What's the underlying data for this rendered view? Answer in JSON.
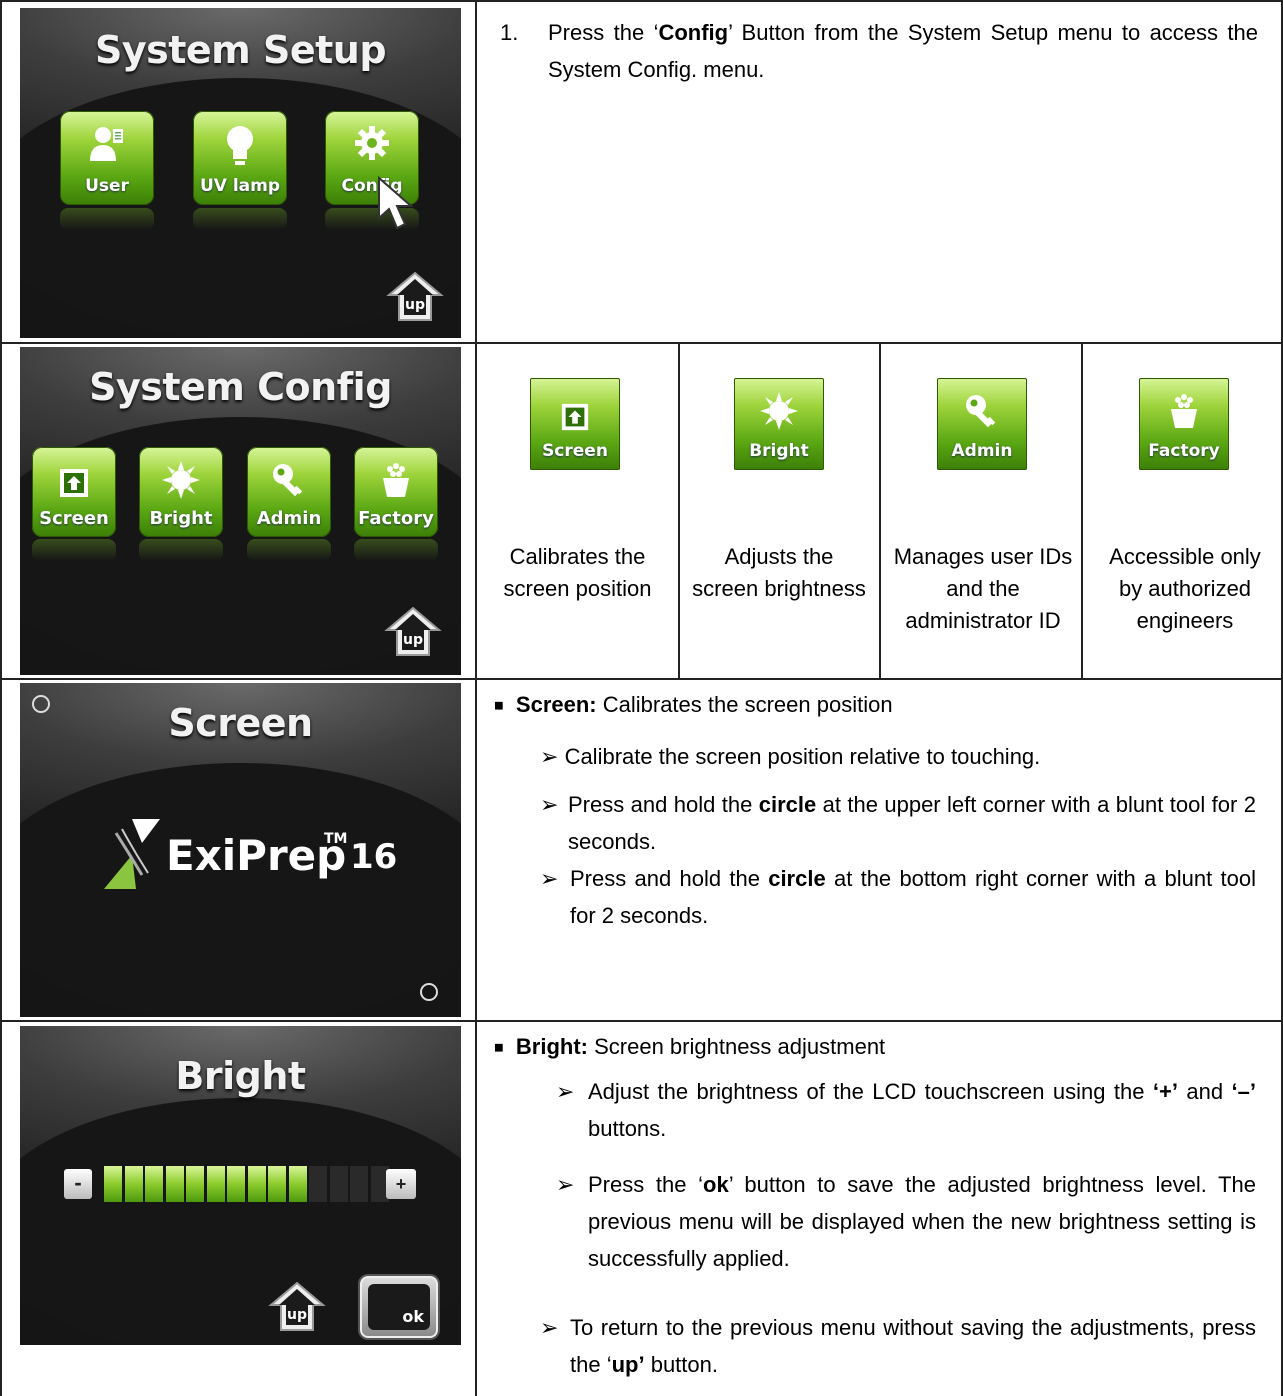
{
  "row1": {
    "screen_title": "System Setup",
    "buttons": [
      "User",
      "UV lamp",
      "Config"
    ],
    "up_label": "up",
    "step_number": "1.",
    "step_pre": "Press the ‘",
    "step_bold": "Config",
    "step_post": "’ Button from the System Setup menu to access the System Config. menu."
  },
  "row2": {
    "screen_title": "System Config",
    "buttons": [
      "Screen",
      "Bright",
      "Admin",
      "Factory"
    ],
    "up_label": "up",
    "cells": [
      {
        "label": "Screen",
        "desc": "Calibrates the screen position"
      },
      {
        "label": "Bright",
        "desc": "Adjusts the screen brightness"
      },
      {
        "label": "Admin",
        "desc": "Manages user IDs and the administrator ID"
      },
      {
        "label": "Factory",
        "desc": "Accessible only by authorized engineers"
      }
    ]
  },
  "row3": {
    "screen_title": "Screen",
    "logo_text": "ExiPrep",
    "logo_tm": "TM",
    "logo_num": "16",
    "heading_bold": "Screen:",
    "heading_rest": " Calibrates the screen position",
    "b1": "Calibrate the screen position relative to touching.",
    "b2_pre": "Press and hold the ",
    "b2_bold": "circle",
    "b2_post": " at the upper left corner with a blunt tool for 2 seconds.",
    "b3_pre": "Press and hold the ",
    "b3_bold": "circle",
    "b3_post": " at the bottom right corner with a blunt tool for 2 seconds."
  },
  "row4": {
    "screen_title": "Bright",
    "minus": "-",
    "plus": "+",
    "brightness_level": 10,
    "brightness_max": 14,
    "up_label": "up",
    "ok_label": "ok",
    "heading_bold": "Bright:",
    "heading_rest": " Screen brightness adjustment",
    "b1_pre": "Adjust the brightness of the LCD touchscreen using the ",
    "b1_plus": "‘+’",
    "b1_mid": " and ",
    "b1_minus": "‘–’",
    "b1_post": " buttons.",
    "b2_pre": "Press the ‘",
    "b2_bold": "ok",
    "b2_post": "’ button to save the adjusted brightness level. The previous menu will be displayed when the new brightness setting is successfully applied.",
    "b3_pre": "To return to the previous menu without saving the adjustments, press the ‘",
    "b3_bold": "up’",
    "b3_post": " button."
  },
  "colors": {
    "accent_green": "#6cb51d",
    "screen_bg": "#151515"
  }
}
